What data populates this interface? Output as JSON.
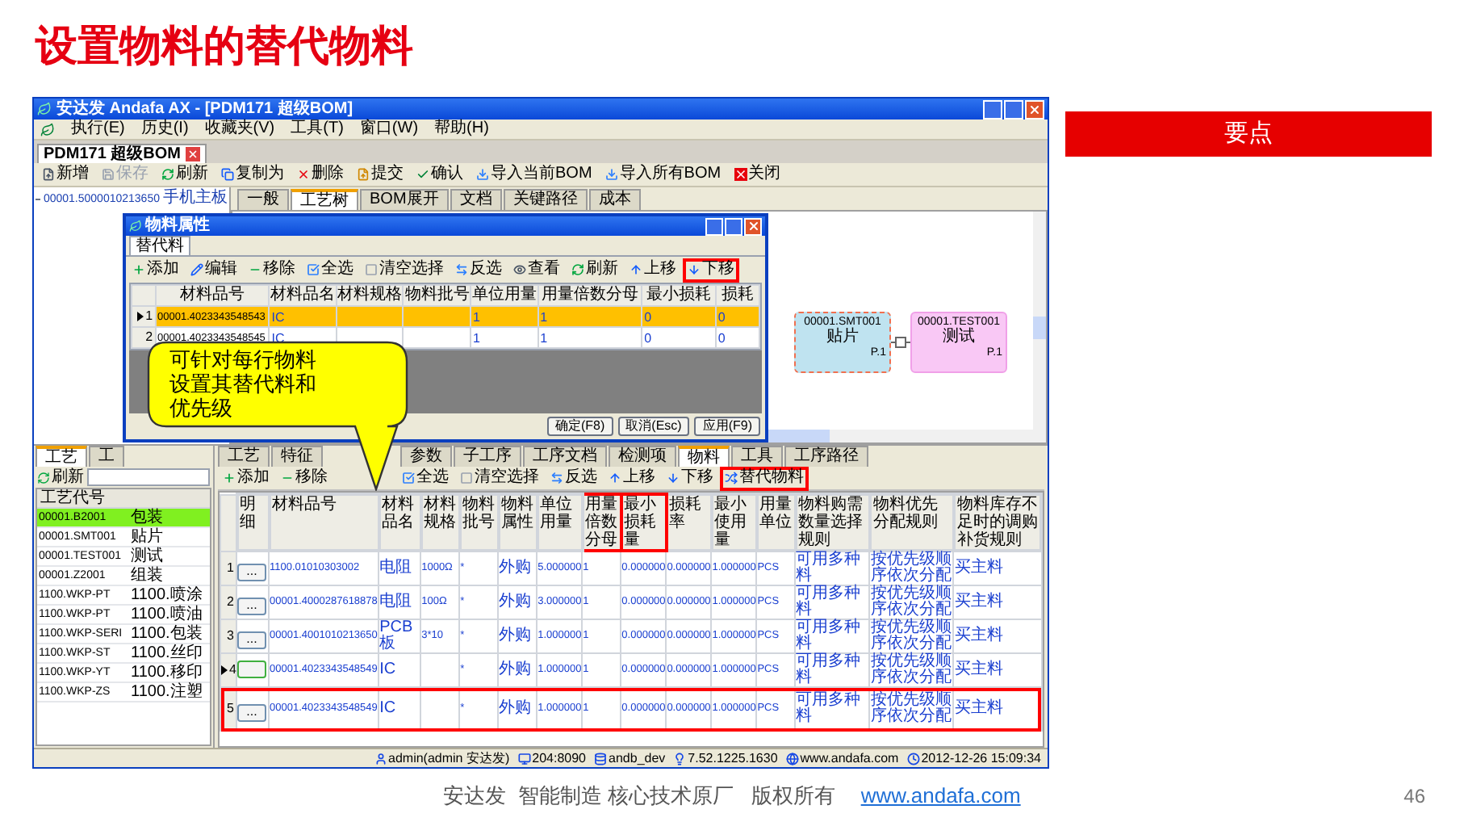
{
  "slide": {
    "title": "设置物料的替代物料",
    "key_points_label": "要点",
    "footer": "安达发  智能制造 核心技术原厂   版权所有",
    "footer_link": "www.andafa.com",
    "page_number": "46"
  },
  "window": {
    "title": "安达发 Andafa AX - [PDM171 超级BOM]"
  },
  "menu": [
    "执行(E)",
    "历史(I)",
    "收藏夹(V)",
    "工具(T)",
    "窗口(W)",
    "帮助(H)"
  ],
  "document_tab": {
    "label": "PDM171 超级BOM"
  },
  "toolbar": [
    {
      "label": "新增",
      "disabled": false
    },
    {
      "label": "保存",
      "disabled": true
    },
    {
      "label": "刷新",
      "disabled": false
    },
    {
      "label": "复制为",
      "disabled": false
    },
    {
      "label": "删除",
      "disabled": false
    },
    {
      "label": "提交",
      "disabled": false
    },
    {
      "label": "确认",
      "disabled": false
    },
    {
      "label": "导入当前BOM",
      "disabled": false
    },
    {
      "label": "导入所有BOM",
      "disabled": false
    },
    {
      "label": "关闭",
      "disabled": false
    }
  ],
  "tree": {
    "items": [
      {
        "code": "00001.5000010213650",
        "name": "手机主板"
      }
    ]
  },
  "main_tabs": [
    {
      "label": "一般",
      "selected": false
    },
    {
      "label": "工艺树",
      "selected": true
    },
    {
      "label": "BOM展开",
      "selected": false
    },
    {
      "label": "文档",
      "selected": false
    },
    {
      "label": "关键路径",
      "selected": false
    },
    {
      "label": "成本",
      "selected": false
    }
  ],
  "diagram": {
    "nodes": [
      {
        "code": "00001.SMT001",
        "name": "贴片",
        "page": "P.1",
        "color": "#bfe3f0",
        "selected": true
      },
      {
        "code": "00001.TEST001",
        "name": "测试",
        "page": "P.1",
        "color": "#f9c8f5",
        "selected": false
      }
    ]
  },
  "dialog": {
    "title": "物料属性",
    "tab": "替代料",
    "toolbar": [
      {
        "label": "添加",
        "highlighted": false
      },
      {
        "label": "编辑",
        "highlighted": false
      },
      {
        "label": "移除",
        "highlighted": false
      },
      {
        "label": "全选",
        "highlighted": false
      },
      {
        "label": "清空选择",
        "highlighted": false
      },
      {
        "label": "反选",
        "highlighted": false
      },
      {
        "label": "查看",
        "highlighted": false
      },
      {
        "label": "刷新",
        "highlighted": false
      },
      {
        "label": "上移",
        "highlighted": false
      },
      {
        "label": "下移",
        "highlighted": true
      }
    ],
    "columns": [
      "材料品号",
      "材料品名",
      "材料规格",
      "物料批号",
      "单位用量",
      "用量倍数分母",
      "最小损耗",
      "损耗"
    ],
    "rows": [
      {
        "num": "1",
        "selected": true,
        "cells": [
          "00001.4023343548543",
          "IC",
          "",
          "",
          "1",
          "1",
          "0",
          "0"
        ]
      },
      {
        "num": "2",
        "selected": false,
        "cells": [
          "00001.4023343548545",
          "IC",
          "",
          "",
          "1",
          "1",
          "0",
          "0"
        ]
      }
    ],
    "buttons": [
      "确定(F8)",
      "取消(Esc)",
      "应用(F9)"
    ]
  },
  "callout": {
    "text": "可针对每行物料设置其替代料和优先级"
  },
  "process_panel": {
    "tabs": [
      {
        "label": "工艺",
        "selected": true
      },
      {
        "label": "工",
        "selected": false
      }
    ],
    "refresh": "刷新",
    "column": "工艺代号",
    "rows": [
      {
        "code": "00001.B2001",
        "name": "包装",
        "selected": true
      },
      {
        "code": "00001.SMT001",
        "name": "贴片",
        "selected": false
      },
      {
        "code": "00001.TEST001",
        "name": "测试",
        "selected": false
      },
      {
        "code": "00001.Z2001",
        "name": "组装",
        "selected": false
      },
      {
        "code": "1100.WKP-PT",
        "name": "1100.喷涂",
        "selected": false
      },
      {
        "code": "1100.WKP-PT",
        "name": "1100.喷油",
        "selected": false
      },
      {
        "code": "1100.WKP-SERI",
        "name": "1100.包装",
        "selected": false
      },
      {
        "code": "1100.WKP-ST",
        "name": "1100.丝印",
        "selected": false
      },
      {
        "code": "1100.WKP-YT",
        "name": "1100.移印",
        "selected": false
      },
      {
        "code": "1100.WKP-ZS",
        "name": "1100.注塑",
        "selected": false
      }
    ]
  },
  "detail_tabs": [
    {
      "label": "工艺",
      "selected": false
    },
    {
      "label": "特征",
      "selected": false
    },
    {
      "label": "参数",
      "selected": false
    },
    {
      "label": "子工序",
      "selected": false
    },
    {
      "label": "工序文档",
      "selected": false
    },
    {
      "label": "检测项",
      "selected": false
    },
    {
      "label": "物料",
      "selected": true
    },
    {
      "label": "工具",
      "selected": false
    },
    {
      "label": "工序路径",
      "selected": false
    }
  ],
  "detail_toolbar": [
    {
      "label": "添加",
      "highlighted": false
    },
    {
      "label": "移除",
      "highlighted": false
    },
    {
      "label": "全选",
      "highlighted": false
    },
    {
      "label": "清空选择",
      "highlighted": false
    },
    {
      "label": "反选",
      "highlighted": false
    },
    {
      "label": "上移",
      "highlighted": false
    },
    {
      "label": "下移",
      "highlighted": false
    },
    {
      "label": "替代物料",
      "highlighted": true
    }
  ],
  "materials": {
    "columns": [
      {
        "label": "明细",
        "highlighted": false
      },
      {
        "label": "材料品号",
        "highlighted": false
      },
      {
        "label": "材料品名",
        "highlighted": false
      },
      {
        "label": "材料规格",
        "highlighted": false
      },
      {
        "label": "物料批号",
        "highlighted": false
      },
      {
        "label": "物料属性",
        "highlighted": false
      },
      {
        "label": "单位用量",
        "highlighted": false
      },
      {
        "label": "用量倍数分母",
        "highlighted": true
      },
      {
        "label": "最小损耗量",
        "highlighted": true
      },
      {
        "label": "损耗率",
        "highlighted": false
      },
      {
        "label": "最小使用量",
        "highlighted": false
      },
      {
        "label": "用量单位",
        "highlighted": false
      },
      {
        "label": "物料购需数量选择规则",
        "highlighted": false
      },
      {
        "label": "物料优先分配规则",
        "highlighted": false
      },
      {
        "label": "物料库存不足时的调购补货规则",
        "highlighted": false
      }
    ],
    "rows": [
      {
        "num": "1",
        "current": false,
        "highlighted": false,
        "cells": [
          "...",
          "1100.01010303002",
          "电阻",
          "1000Ω",
          "*",
          "外购",
          "5.000000",
          "1",
          "0.000000",
          "0.000000",
          "1.000000",
          "PCS",
          "可用多种料",
          "按优先级顺序依次分配",
          "买主料"
        ]
      },
      {
        "num": "2",
        "current": false,
        "highlighted": false,
        "cells": [
          "...",
          "00001.4000287618878",
          "电阻",
          "100Ω",
          "*",
          "外购",
          "3.000000",
          "1",
          "0.000000",
          "0.000000",
          "1.000000",
          "PCS",
          "可用多种料",
          "按优先级顺序依次分配",
          "买主料"
        ]
      },
      {
        "num": "3",
        "current": false,
        "highlighted": false,
        "cells": [
          "...",
          "00001.4001010213650",
          "PCB板",
          "3*10",
          "*",
          "外购",
          "1.000000",
          "1",
          "0.000000",
          "0.000000",
          "1.000000",
          "PCS",
          "可用多种料",
          "按优先级顺序依次分配",
          "买主料"
        ]
      },
      {
        "num": "4",
        "current": true,
        "highlighted": false,
        "cells": [
          "",
          "00001.4023343548549",
          "IC",
          "",
          "*",
          "外购",
          "1.000000",
          "1",
          "0.000000",
          "0.000000",
          "1.000000",
          "PCS",
          "可用多种料",
          "按优先级顺序依次分配",
          "买主料"
        ]
      },
      {
        "num": "5",
        "current": false,
        "highlighted": true,
        "cells": [
          "...",
          "00001.4023343548549",
          "IC",
          "",
          "*",
          "外购",
          "1.000000",
          "1",
          "0.000000",
          "0.000000",
          "1.000000",
          "PCS",
          "可用多种料",
          "按优先级顺序依次分配",
          "买主料"
        ]
      }
    ]
  },
  "status_bar": [
    "admin(admin 安达发)",
    "204:8090",
    "andb_dev",
    "7.52.1225.1630",
    "www.andafa.com",
    "2012-12-26 15:09:34"
  ]
}
